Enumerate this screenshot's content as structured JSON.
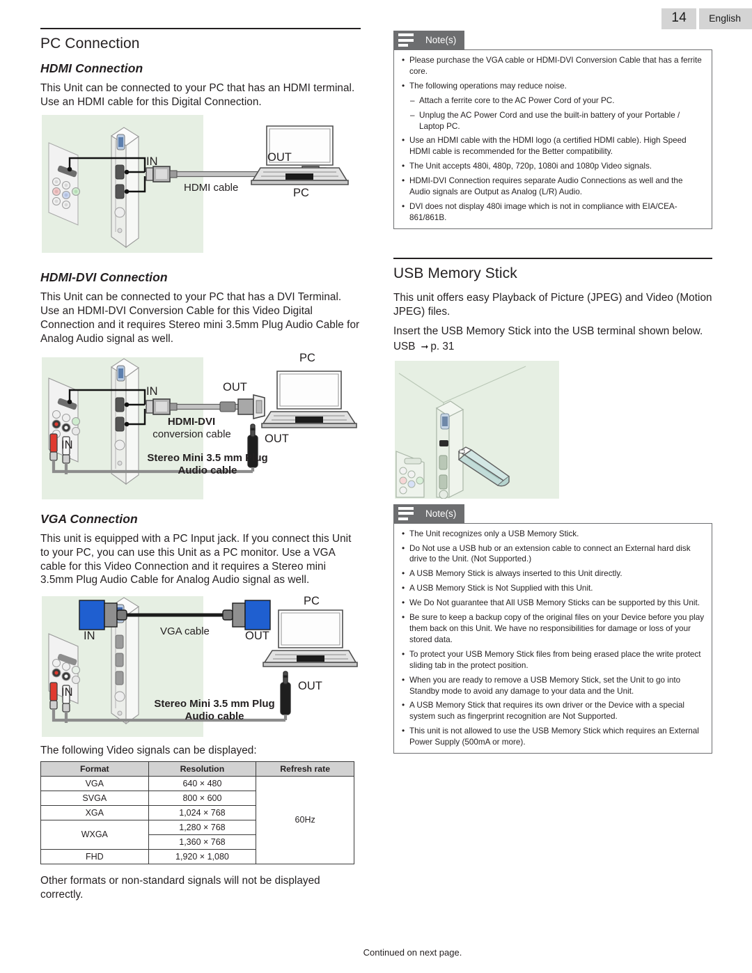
{
  "header": {
    "page_number": "14",
    "language": "English"
  },
  "left": {
    "section_title": "PC Connection",
    "hdmi": {
      "sub": "HDMI Connection",
      "para": "This Unit can be connected to your PC that has an HDMI terminal. Use an HDMI cable for this Digital Connection.",
      "labels": {
        "in": "IN",
        "out": "OUT",
        "cable": "HDMI cable",
        "pc": "PC"
      }
    },
    "hdmi_dvi": {
      "sub": "HDMI-DVI Connection",
      "para": "This Unit can be connected to your PC that has a DVI Terminal. Use an HDMI-DVI Conversion Cable for this Video Digital Connection and it requires Stereo mini 3.5mm Plug Audio Cable for Analog Audio signal as well.",
      "labels": {
        "pc": "PC",
        "in": "IN",
        "out": "OUT",
        "cable_l1": "HDMI-DVI",
        "cable_l2": "conversion cable",
        "audio_in": "IN",
        "audio_out": "OUT",
        "audio_l1": "Stereo Mini 3.5 mm Plug",
        "audio_l2": "Audio cable"
      }
    },
    "vga": {
      "sub": "VGA Connection",
      "para": "This unit is equipped with a PC Input jack. If you connect this Unit to your PC, you can use this Unit as a PC monitor. Use a VGA cable for this Video Connection and it requires a Stereo mini 3.5mm Plug Audio Cable for Analog Audio signal as well.",
      "labels": {
        "pc": "PC",
        "in": "IN",
        "out": "OUT",
        "cable": "VGA cable",
        "audio_in": "IN",
        "audio_out": "OUT",
        "audio_l1": "Stereo Mini 3.5 mm Plug",
        "audio_l2": "Audio cable"
      }
    },
    "table_intro": "The following Video signals can be displayed:",
    "table": {
      "headers": [
        "Format",
        "Resolution",
        "Refresh rate"
      ],
      "rows": [
        {
          "format": "VGA",
          "resolution": "640 × 480"
        },
        {
          "format": "SVGA",
          "resolution": "800 × 600"
        },
        {
          "format": "XGA",
          "resolution": "1,024 × 768"
        },
        {
          "format": "WXGA",
          "resolution": "1,280 × 768"
        },
        {
          "format": "",
          "resolution": "1,360 × 768"
        },
        {
          "format": "FHD",
          "resolution": "1,920 × 1,080"
        }
      ],
      "refresh_rate": "60Hz"
    },
    "table_footnote": "Other formats or non-standard signals will not be displayed correctly."
  },
  "right": {
    "notes1": {
      "title": "Note(s)",
      "items": [
        {
          "type": "bullet",
          "text": "Please purchase the VGA cable or HDMI-DVI Conversion Cable that has a ferrite core."
        },
        {
          "type": "bullet",
          "text": "The following operations may reduce noise."
        },
        {
          "type": "dash",
          "text": "Attach a ferrite core to the AC Power Cord of your PC."
        },
        {
          "type": "dash",
          "text": "Unplug the AC Power Cord and use the built-in battery of your Portable / Laptop PC."
        },
        {
          "type": "bullet",
          "text": "Use an HDMI cable with the HDMI logo (a certified HDMI cable). High Speed HDMI cable is recommended for the Better compatibility."
        },
        {
          "type": "bullet",
          "text": "The Unit accepts 480i, 480p, 720p, 1080i and 1080p Video signals."
        },
        {
          "type": "bullet",
          "text": "HDMI-DVI Connection requires separate Audio Connections as well and the Audio signals are Output as Analog (L/R) Audio."
        },
        {
          "type": "bullet",
          "text": "DVI does not display 480i image which is not in compliance with EIA/CEA-861/861B."
        }
      ]
    },
    "usb": {
      "section_title": "USB Memory Stick",
      "para1": "This unit offers easy Playback of Picture (JPEG) and Video (Motion JPEG) files.",
      "para2": "Insert the USB Memory Stick into the USB terminal shown below.",
      "ref_label": "USB",
      "ref_target": "p. 31"
    },
    "notes2": {
      "title": "Note(s)",
      "items": [
        {
          "type": "bullet",
          "text": "The Unit recognizes only a USB Memory Stick."
        },
        {
          "type": "bullet",
          "text": "Do Not use a USB hub or an extension cable to connect an External hard disk drive to the Unit. (Not Supported.)"
        },
        {
          "type": "bullet",
          "text": "A USB Memory Stick is always inserted to this Unit directly."
        },
        {
          "type": "bullet",
          "text": "A USB Memory Stick is Not Supplied with this Unit."
        },
        {
          "type": "bullet",
          "text": "We Do Not guarantee that All USB Memory Sticks can be supported by this Unit."
        },
        {
          "type": "bullet",
          "text": "Be sure to keep a backup copy of the original files on your Device before you play them back on this Unit. We have no responsibilities for damage or loss of your stored data."
        },
        {
          "type": "bullet",
          "text": "To protect your USB Memory Stick files from being erased place the write protect sliding tab in the protect position."
        },
        {
          "type": "bullet",
          "text": "When you are ready to remove a USB Memory Stick, set the Unit to go into Standby mode to avoid any damage to your data and the Unit."
        },
        {
          "type": "bullet",
          "text": "A USB Memory Stick that requires its own driver or the Device with a special system such as fingerprint recognition are Not Supported."
        },
        {
          "type": "bullet",
          "text": "This unit is not allowed to use the USB Memory Stick which requires an External Power Supply (500mA or more)."
        }
      ]
    }
  },
  "footer": {
    "text": "Continued on next page."
  },
  "colors": {
    "diagram_bg": "#e6efe3",
    "note_tab": "#6d6e70",
    "header_chip": "#d4d4d4",
    "vga_blue": "#1f5fd0",
    "rca_red": "#e8312a",
    "text": "#231f20"
  }
}
